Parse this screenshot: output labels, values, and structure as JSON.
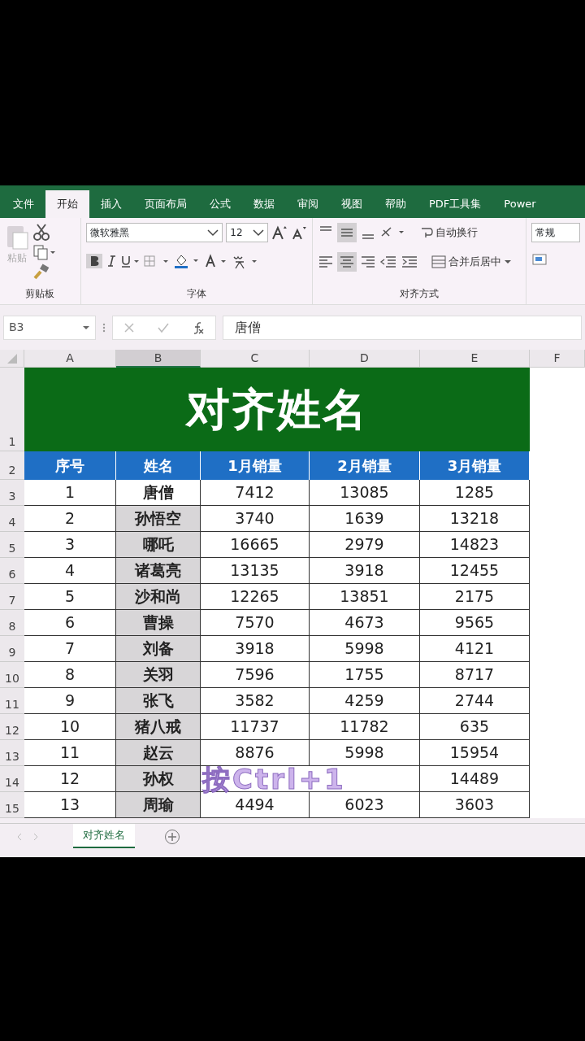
{
  "ribbon_tabs": [
    {
      "label": "文件",
      "selected": false
    },
    {
      "label": "开始",
      "selected": true
    },
    {
      "label": "插入",
      "selected": false
    },
    {
      "label": "页面布局",
      "selected": false
    },
    {
      "label": "公式",
      "selected": false
    },
    {
      "label": "数据",
      "selected": false
    },
    {
      "label": "审阅",
      "selected": false
    },
    {
      "label": "视图",
      "selected": false
    },
    {
      "label": "帮助",
      "selected": false
    },
    {
      "label": "PDF工具集",
      "selected": false
    },
    {
      "label": "Power",
      "selected": false
    }
  ],
  "ribbon": {
    "paste_label": "粘贴",
    "font_name": "微软雅黑",
    "font_size": "12",
    "bold": true,
    "center_aligned": true,
    "wrap_text": "自动换行",
    "merge_center": "合并后居中",
    "number_format": "常规",
    "groups": [
      "剪贴板",
      "字体",
      "对齐方式"
    ]
  },
  "formula_bar": {
    "name_box": "B3",
    "content": "唐僧"
  },
  "columns": [
    {
      "label": "A",
      "selected": false
    },
    {
      "label": "B",
      "selected": true
    },
    {
      "label": "C",
      "selected": false
    },
    {
      "label": "D",
      "selected": false
    },
    {
      "label": "E",
      "selected": false
    },
    {
      "label": "F",
      "selected": false
    }
  ],
  "sheet": {
    "title_row_number": "1",
    "header_row_number": "2",
    "title": "对齐姓名",
    "headers": [
      "序号",
      "姓名",
      "1月销量",
      "2月销量",
      "3月销量"
    ],
    "rows": [
      {
        "number": "3",
        "active": true,
        "cells": [
          "1",
          "唐僧",
          "7412",
          "13085",
          "1285"
        ]
      },
      {
        "number": "4",
        "active": false,
        "cells": [
          "2",
          "孙悟空",
          "3740",
          "1639",
          "13218"
        ]
      },
      {
        "number": "5",
        "active": false,
        "cells": [
          "3",
          "哪吒",
          "16665",
          "2979",
          "14823"
        ]
      },
      {
        "number": "6",
        "active": false,
        "cells": [
          "4",
          "诸葛亮",
          "13135",
          "3918",
          "12455"
        ]
      },
      {
        "number": "7",
        "active": false,
        "cells": [
          "5",
          "沙和尚",
          "12265",
          "13851",
          "2175"
        ]
      },
      {
        "number": "8",
        "active": false,
        "cells": [
          "6",
          "曹操",
          "7570",
          "4673",
          "9565"
        ]
      },
      {
        "number": "9",
        "active": false,
        "cells": [
          "7",
          "刘备",
          "3918",
          "5998",
          "4121"
        ]
      },
      {
        "number": "10",
        "active": false,
        "cells": [
          "8",
          "关羽",
          "7596",
          "1755",
          "8717"
        ]
      },
      {
        "number": "11",
        "active": false,
        "cells": [
          "9",
          "张飞",
          "3582",
          "4259",
          "2744"
        ]
      },
      {
        "number": "12",
        "active": false,
        "cells": [
          "10",
          "猪八戒",
          "11737",
          "11782",
          "635"
        ]
      },
      {
        "number": "13",
        "active": false,
        "cells": [
          "11",
          "赵云",
          "8876",
          "5998",
          "15954"
        ]
      },
      {
        "number": "14",
        "active": false,
        "cells": [
          "12",
          "孙权",
          null,
          null,
          "14489"
        ]
      },
      {
        "number": "15",
        "active": false,
        "cells": [
          "13",
          "周瑜",
          "4494",
          "6023",
          "3603"
        ]
      }
    ]
  },
  "overlay_caption": "按Ctrl+1",
  "sheet_tabs": [
    {
      "label": "对齐姓名",
      "selected": true
    }
  ]
}
